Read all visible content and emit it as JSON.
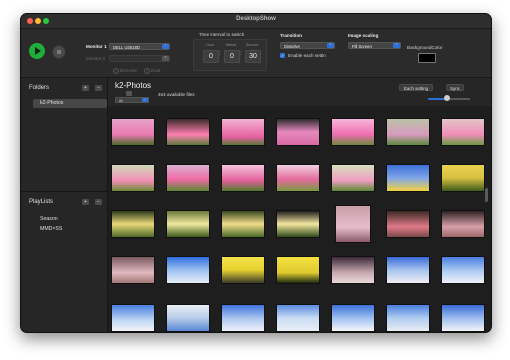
{
  "window": {
    "title": "DesktopShow"
  },
  "toolbar": {
    "monitor1_label": "Monitor 1",
    "monitor1_value": "DELL U2518D",
    "monitor2_label": "Monitor 2",
    "monitor2_value": "",
    "discrete_label": "Discrete",
    "dual_label": "Dual",
    "time_label": "Time interval to switch",
    "time_units": {
      "hour": "Hour",
      "minute": "Minute",
      "second": "Second"
    },
    "time_values": {
      "hour": "0",
      "minute": "0",
      "second": "30"
    },
    "time_sep": ":",
    "transition_label": "Transition",
    "transition_value": "Dissolve",
    "enable_each_label": "Enable each settin",
    "scaling_label": "Image scaling",
    "scaling_value": "Fill Screen",
    "bgcolor_label": "BackgroundColor",
    "bgcolor_value": "#000000"
  },
  "sidebar": {
    "folders_header": "Folders",
    "folders": [
      "k2-Photos"
    ],
    "playlists_header": "PlayLists",
    "playlists": [
      "Season",
      "MMD×SS"
    ],
    "add_symbol": "+",
    "remove_symbol": "−"
  },
  "main": {
    "title": "k2-Photos",
    "count_text": "464 available files",
    "each_setting_button": "Each setting",
    "sync_button": "Sync",
    "filter_value": "All"
  }
}
